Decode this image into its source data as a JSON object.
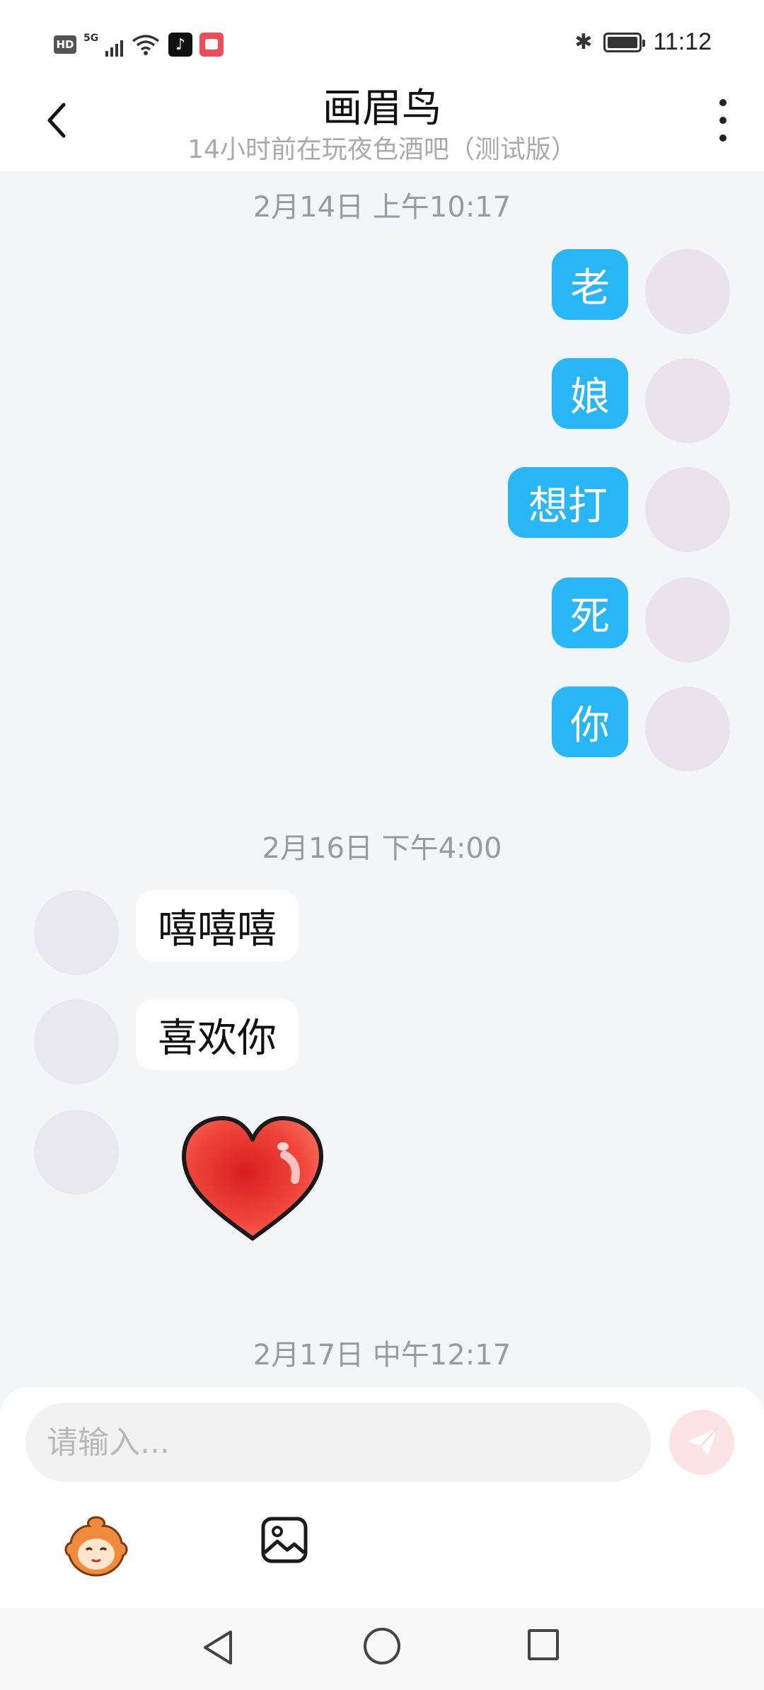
{
  "status_bar": {
    "hd": "HD",
    "network": "5G",
    "time": "11:12"
  },
  "header": {
    "title": "画眉鸟",
    "subtitle": "14小时前在玩夜色酒吧（测试版）"
  },
  "chat": {
    "timestamps": [
      "2月14日 上午10:17",
      "2月16日 下午4:00",
      "2月17日 中午12:17"
    ],
    "outgoing": [
      "老",
      "娘",
      "想打",
      "死",
      "你"
    ],
    "incoming": [
      "嘻嘻嘻",
      "喜欢你"
    ],
    "sticker": "heart"
  },
  "input": {
    "placeholder": "请输入..."
  },
  "colors": {
    "outgoing_bubble": "#29b6f6",
    "incoming_bubble": "#ffffff",
    "background": "#f3f6f9",
    "send_button": "#fde3e3"
  },
  "icons": {
    "back": "chevron-left-icon",
    "more": "more-vertical-icon",
    "send": "paper-plane-icon",
    "emoji": "emoji-avatar-icon",
    "image": "image-icon"
  }
}
